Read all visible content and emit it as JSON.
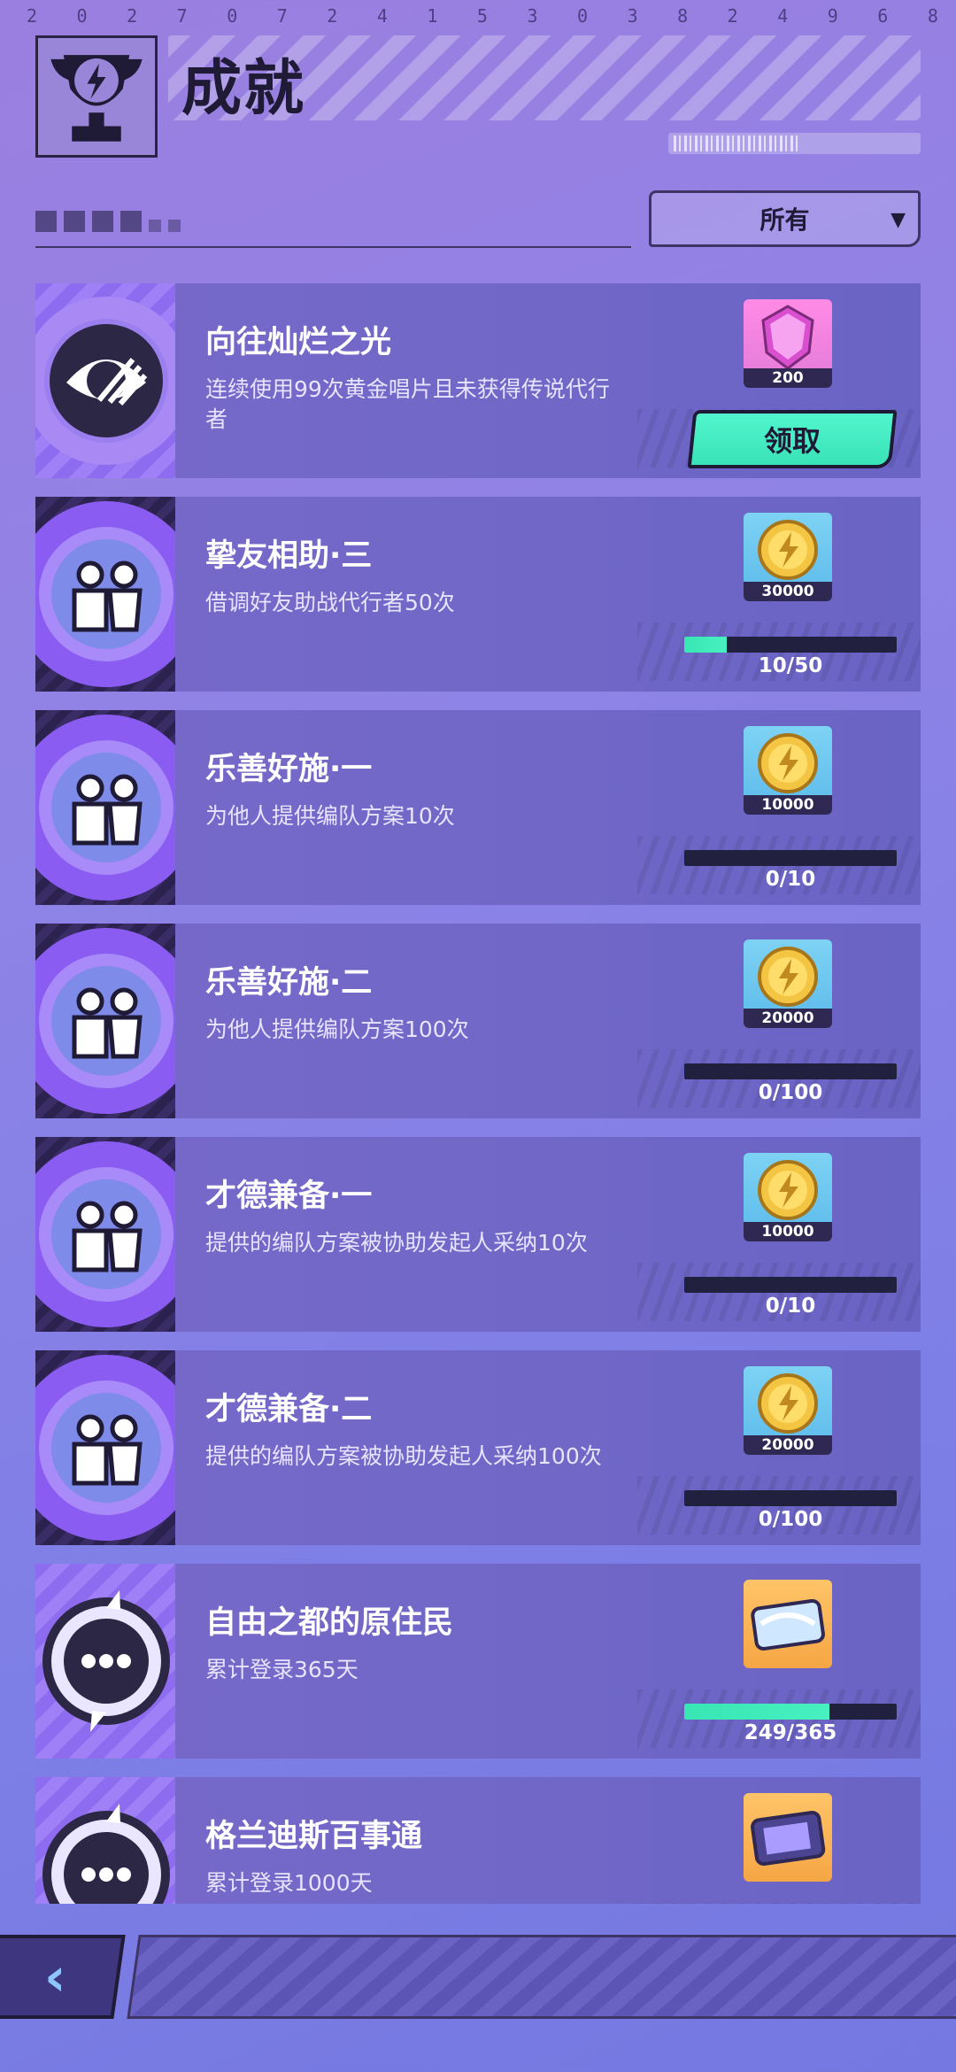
{
  "top_digits": [
    "2",
    "0",
    "2",
    "7",
    "0",
    "7",
    "2",
    "4",
    "1",
    "5",
    "3",
    "0",
    "3",
    "8",
    "2",
    "4",
    "9",
    "6",
    "8"
  ],
  "header": {
    "title": "成就"
  },
  "filter": {
    "label": "所有"
  },
  "achievements": [
    {
      "name": "向往灿烂之光",
      "desc": "连续使用99次黄金唱片且未获得传说代行者",
      "reward_type": "gem",
      "reward_value": "200",
      "status": "claimable",
      "claim_label": "领取"
    },
    {
      "name": "挚友相助·三",
      "desc": "借调好友助战代行者50次",
      "reward_type": "coin",
      "reward_value": "30000",
      "progress_text": "10/50",
      "progress": 0.2
    },
    {
      "name": "乐善好施·一",
      "desc": "为他人提供编队方案10次",
      "reward_type": "coin",
      "reward_value": "10000",
      "progress_text": "0/10",
      "progress": 0
    },
    {
      "name": "乐善好施·二",
      "desc": "为他人提供编队方案100次",
      "reward_type": "coin",
      "reward_value": "20000",
      "progress_text": "0/100",
      "progress": 0
    },
    {
      "name": "才德兼备·一",
      "desc": "提供的编队方案被协助发起人采纳10次",
      "reward_type": "coin",
      "reward_value": "10000",
      "progress_text": "0/10",
      "progress": 0
    },
    {
      "name": "才德兼备·二",
      "desc": "提供的编队方案被协助发起人采纳100次",
      "reward_type": "coin",
      "reward_value": "20000",
      "progress_text": "0/100",
      "progress": 0
    },
    {
      "name": "自由之都的原住民",
      "desc": "累计登录365天",
      "reward_type": "ticket",
      "progress_text": "249/365",
      "progress": 0.682
    },
    {
      "name": "格兰迪斯百事通",
      "desc": "累计登录1000天",
      "reward_type": "ticket2"
    }
  ],
  "back_button": {
    "icon": "chevron-left-icon"
  },
  "colors": {
    "accent": "#43ecc0",
    "dark": "#1f1a35"
  }
}
